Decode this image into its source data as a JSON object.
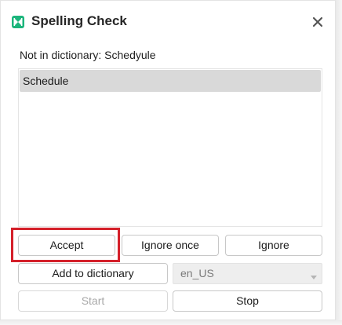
{
  "window": {
    "title": "Spelling Check",
    "accent_color": "#1cb57c",
    "close_icon": "close-icon"
  },
  "message": "Not in dictionary: Schedyule",
  "suggestions": [
    "Schedule"
  ],
  "buttons": {
    "accept": "Accept",
    "ignore_once": "Ignore once",
    "ignore": "Ignore",
    "add_to_dictionary": "Add to dictionary",
    "start": "Start",
    "stop": "Stop"
  },
  "language": {
    "selected": "en_US"
  },
  "highlight_color": "#d4202a"
}
